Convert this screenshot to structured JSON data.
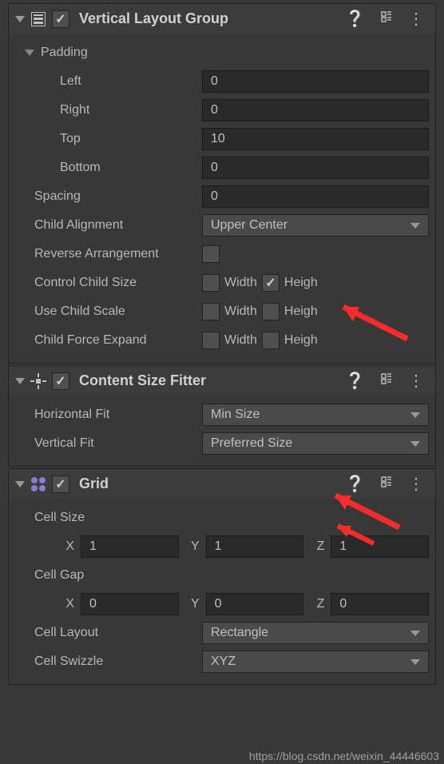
{
  "vlg": {
    "title": "Vertical Layout Group",
    "enabled": true,
    "padding_label": "Padding",
    "left_label": "Left",
    "left": "0",
    "right_label": "Right",
    "right": "0",
    "top_label": "Top",
    "top": "10",
    "bottom_label": "Bottom",
    "bottom": "0",
    "spacing_label": "Spacing",
    "spacing": "0",
    "child_align_label": "Child Alignment",
    "child_align": "Upper Center",
    "reverse_label": "Reverse Arrangement",
    "reverse": false,
    "ccs_label": "Control Child Size",
    "ucs_label": "Use Child Scale",
    "cfe_label": "Child Force Expand",
    "width_label": "Width",
    "height_label": "Heigh",
    "ccs_width": false,
    "ccs_height": true,
    "ucs_width": false,
    "ucs_height": false,
    "cfe_width": false,
    "cfe_height": false
  },
  "csf": {
    "title": "Content Size Fitter",
    "enabled": true,
    "hfit_label": "Horizontal Fit",
    "hfit": "Min Size",
    "vfit_label": "Vertical Fit",
    "vfit": "Preferred Size"
  },
  "grid": {
    "title": "Grid",
    "enabled": true,
    "cell_size_label": "Cell Size",
    "cs_x": "1",
    "cs_y": "1",
    "cs_z": "1",
    "cell_gap_label": "Cell Gap",
    "cg_x": "0",
    "cg_y": "0",
    "cg_z": "0",
    "x_label": "X",
    "y_label": "Y",
    "z_label": "Z",
    "cell_layout_label": "Cell Layout",
    "cell_layout": "Rectangle",
    "cell_swizzle_label": "Cell Swizzle",
    "cell_swizzle": "XYZ"
  },
  "watermark": "https://blog.csdn.net/weixin_44446603"
}
